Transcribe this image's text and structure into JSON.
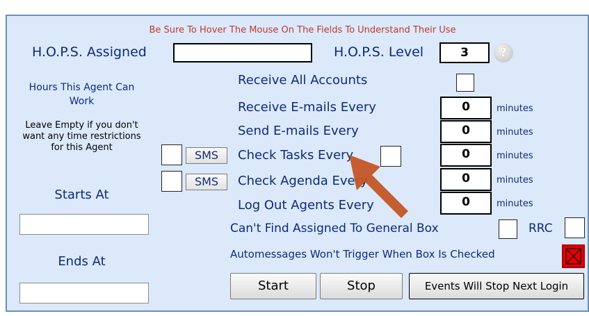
{
  "header": {
    "hint": "Be Sure To Hover The Mouse On The Fields To Understand Their Use"
  },
  "hops": {
    "assigned_label": "H.O.P.S. Assigned",
    "assigned_value": "",
    "level_label": "H.O.P.S. Level",
    "level_value": "3",
    "help_icon": "?"
  },
  "left": {
    "hours_title": "Hours This Agent Can Work",
    "hours_note": "Leave Empty if you don't want any time restrictions for this Agent",
    "starts_label": "Starts At",
    "starts_value": "",
    "ends_label": "Ends At",
    "ends_value": ""
  },
  "sms_label": "SMS",
  "settings": [
    {
      "label": "Receive All Accounts"
    },
    {
      "label": "Receive E-mails Every",
      "value": "0",
      "unit": "minutes"
    },
    {
      "label": "Send E-mails Every",
      "value": "0",
      "unit": "minutes"
    },
    {
      "label": "Check Tasks Every",
      "value": "0",
      "unit": "minutes"
    },
    {
      "label": "Check Agenda Every",
      "value": "0",
      "unit": "minutes"
    },
    {
      "label": "Log Out Agents Every",
      "value": "0",
      "unit": "minutes"
    }
  ],
  "general_box_label": "Can't Find Assigned To General Box",
  "rrc_label": "RRC",
  "automessages_label": "Automessages Won't Trigger When Box Is Checked",
  "buttons": {
    "start": "Start",
    "stop": "Stop",
    "events": "Events Will Stop Next Login"
  },
  "colors": {
    "panel": "#dbe9fb",
    "label": "#0e2a78",
    "hint": "#c0392b",
    "checked_box": "#e60000",
    "arrow": "#c4501f"
  }
}
